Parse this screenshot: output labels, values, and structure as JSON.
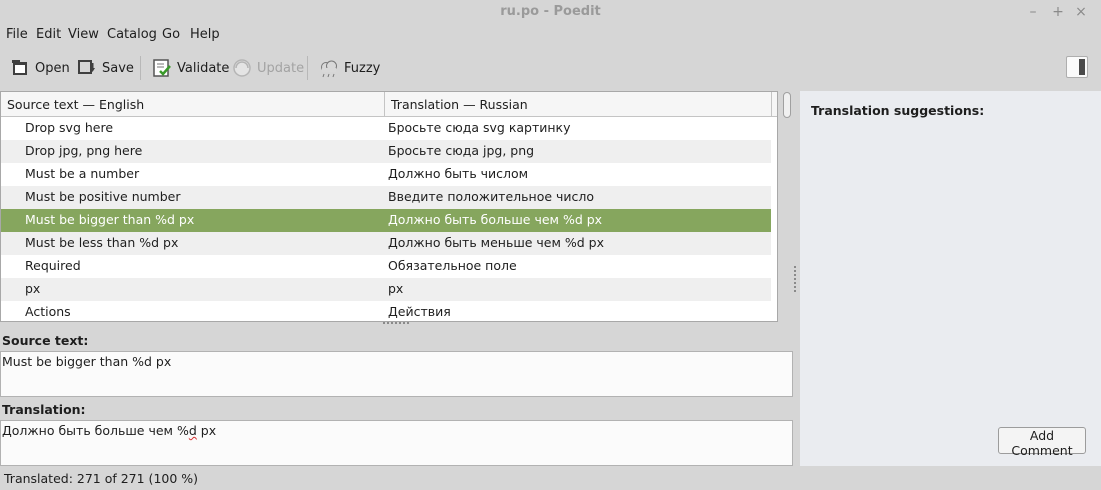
{
  "window": {
    "title": "ru.po - Poedit",
    "controls": [
      "–",
      "+",
      "×"
    ]
  },
  "menu": [
    "File",
    "Edit",
    "View",
    "Catalog",
    "Go",
    "Help"
  ],
  "toolbar": {
    "open": "Open",
    "save": "Save",
    "validate": "Validate",
    "update": "Update",
    "fuzzy": "Fuzzy"
  },
  "list": {
    "columns": {
      "source": "Source text — English",
      "translation": "Translation — Russian"
    },
    "rows": [
      {
        "source": "Drop svg here",
        "translation": "Бросьте сюда svg картинку"
      },
      {
        "source": "Drop jpg, png here",
        "translation": "Бросьте сюда jpg, png"
      },
      {
        "source": "Must be a number",
        "translation": "Должно быть числом"
      },
      {
        "source": "Must be positive number",
        "translation": "Введите положительное число"
      },
      {
        "source": "Must be bigger than %d px",
        "translation": "Должно быть больше чем %d px",
        "selected": true
      },
      {
        "source": "Must be less than %d px",
        "translation": "Должно быть меньше чем %d px"
      },
      {
        "source": "Required",
        "translation": "Обязательное поле"
      },
      {
        "source": "px",
        "translation": "px"
      },
      {
        "source": "Actions",
        "translation": "Действия"
      }
    ]
  },
  "editor": {
    "source_label": "Source text:",
    "source_value": "Must be bigger than %d px",
    "translation_label": "Translation:",
    "translation_pre": "Должно быть больше чем %",
    "translation_misspelled": "d",
    "translation_post": " px"
  },
  "sidebar": {
    "title": "Translation suggestions:",
    "add_comment": "Add Comment"
  },
  "status": {
    "text": "Translated: 271 of 271 (100 %)"
  },
  "colors": {
    "selected_row": "#86a65e",
    "pane_background": "#eaecf0"
  }
}
